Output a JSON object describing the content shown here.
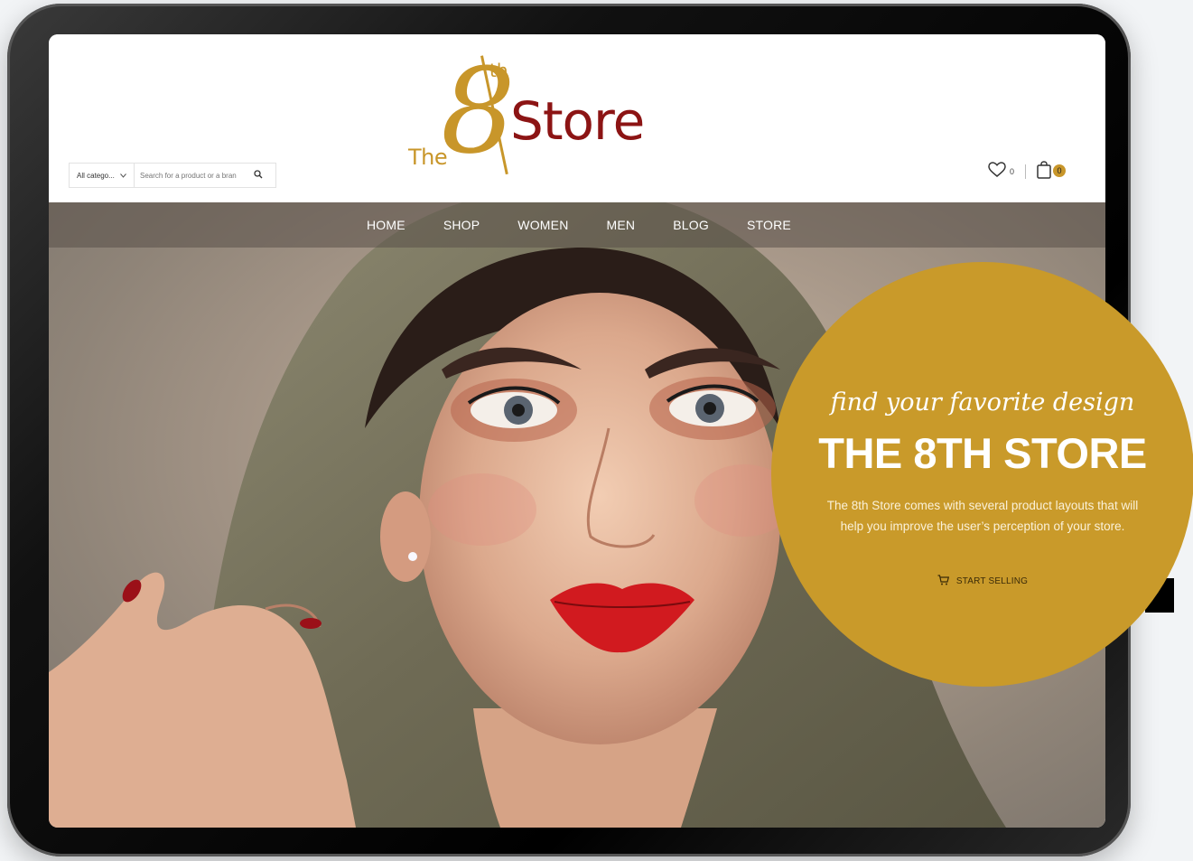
{
  "logo": {
    "the": "The",
    "eight": "8",
    "th": "th",
    "store": "Store"
  },
  "search": {
    "category": "All catego...",
    "placeholder": "Search for a product or a bran"
  },
  "header": {
    "wishlist_count": "0",
    "cart_count": "0"
  },
  "nav": {
    "items": [
      "HOME",
      "SHOP",
      "WOMEN",
      "MEN",
      "BLOG",
      "STORE"
    ]
  },
  "promo": {
    "script": "find your favorite design",
    "title": "THE 8TH STORE",
    "desc_line1": "The 8th Store comes with several product layouts that will",
    "desc_line2": "help you improve the user’s perception of your store.",
    "cta": "START SELLING"
  },
  "colors": {
    "gold": "#c99a2a",
    "maroon": "#8c1414",
    "nav_overlay": "rgba(90,80,72,0.55)"
  },
  "icons": {
    "search": "search-icon",
    "wishlist": "heart-icon",
    "cart": "shopping-bag-icon",
    "cta": "cart-icon",
    "dropdown": "chevron-down-icon"
  }
}
